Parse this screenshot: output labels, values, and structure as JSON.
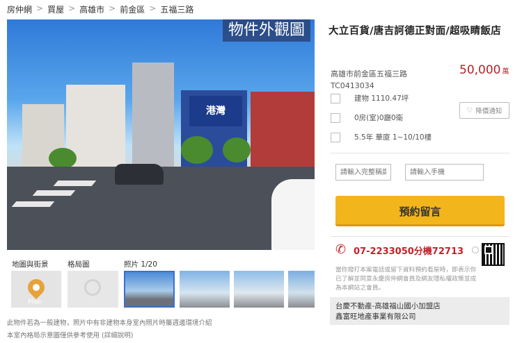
{
  "breadcrumb": [
    "房仲網",
    "買屋",
    "高雄市",
    "前金區",
    "五福三路"
  ],
  "breadcrumb_sep": ">",
  "photo": {
    "overlay_label": "物件外觀圖",
    "sign_text": "港灣"
  },
  "gallery": {
    "tabs": {
      "map": "地圖與街景",
      "floorplan": "格局圖",
      "photos_label": "照片 1/20"
    },
    "map_thumb_text": "Map"
  },
  "notes": [
    "此物件若為一般建物，照片中有非建物本身室內照片時屬週邊環境介紹",
    "本室內格局示意圖僅供參考使用 (詳細說明)"
  ],
  "listing": {
    "title": "大立百貨/唐吉訶德正對面/超吸睛飯店",
    "address": "高雄市前金區五福三路",
    "code": "TC0413034",
    "price": "50,000",
    "price_unit": "萬",
    "area": "建物 1110.47坪",
    "rooms": "0房(室)0廳0衛",
    "age_floor": "5.5年  華廈  1~10/10樓",
    "notify_label": "降價通知"
  },
  "form": {
    "name_placeholder": "請輸入完整稱謂",
    "phone_placeholder": "請輸入手機",
    "book_label": "預約留言"
  },
  "contact": {
    "phone": "07-2233050分機72713",
    "legal_text": "當你撥打本案電話或留下資料預約看屋時，即表示你已了解並同意永慶房仲網會員及網友隱私權政策並成為本網站之會員。",
    "agency_line1": "台慶不動產-高雄福山國小加盟店",
    "agency_line2": "鑫富旺地產事業有限公司"
  },
  "colors": {
    "price_red": "#b3232a",
    "book_button": "#f3b51c",
    "phone_red": "#c02228"
  }
}
